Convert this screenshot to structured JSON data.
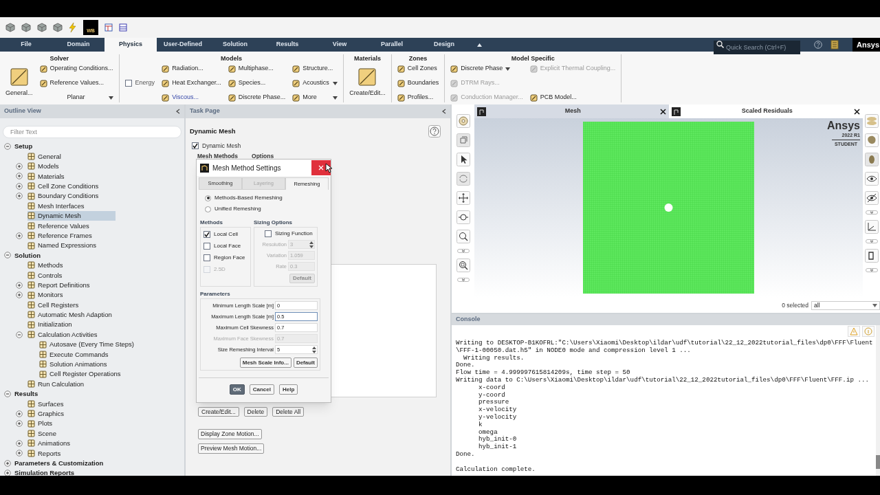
{
  "quick_access": {
    "badge": "WB"
  },
  "menu_tabs": [
    {
      "label": "File",
      "selected": false
    },
    {
      "label": "Domain",
      "selected": false
    },
    {
      "label": "Physics",
      "selected": true
    },
    {
      "label": "User-Defined",
      "selected": false
    },
    {
      "label": "Solution",
      "selected": false
    },
    {
      "label": "Results",
      "selected": false
    },
    {
      "label": "View",
      "selected": false
    },
    {
      "label": "Parallel",
      "selected": false
    },
    {
      "label": "Design",
      "selected": false
    }
  ],
  "quick_search": {
    "placeholder": "Quick Search (Ctrl+F)"
  },
  "brand": "Ansys",
  "ribbon": [
    {
      "title": "Solver",
      "columns": [
        [
          {
            "kind": "large",
            "label": "General...",
            "disabled": false,
            "highlighted": false
          }
        ],
        [
          {
            "kind": "small",
            "label": "Operating Conditions...",
            "disabled": false,
            "highlighted": false
          },
          {
            "kind": "small",
            "label": "Reference Values...",
            "disabled": false,
            "highlighted": false
          },
          {
            "kind": "select",
            "label": "Planar",
            "disabled": false,
            "highlighted": false
          }
        ]
      ]
    },
    {
      "title": "Models",
      "columns": [
        [
          {
            "kind": "check",
            "label": "Energy",
            "checked": false,
            "disabled": false,
            "highlighted": false
          }
        ],
        [
          {
            "kind": "small",
            "label": "Radiation...",
            "disabled": false,
            "highlighted": false
          },
          {
            "kind": "small",
            "label": "Heat Exchanger...",
            "disabled": false,
            "highlighted": false
          },
          {
            "kind": "small",
            "label": "Viscous...",
            "disabled": false,
            "highlighted": true
          }
        ],
        [
          {
            "kind": "small",
            "label": "Multiphase...",
            "disabled": false,
            "highlighted": false
          },
          {
            "kind": "small",
            "label": "Species...",
            "disabled": false,
            "highlighted": false
          },
          {
            "kind": "small",
            "label": "Discrete Phase...",
            "disabled": false,
            "highlighted": false
          }
        ],
        [
          {
            "kind": "small",
            "label": "Structure...",
            "disabled": false,
            "highlighted": false
          },
          {
            "kind": "menu",
            "label": "Acoustics",
            "disabled": false,
            "highlighted": false
          },
          {
            "kind": "menu",
            "label": "More",
            "disabled": false,
            "highlighted": false
          }
        ]
      ]
    },
    {
      "title": "Materials",
      "columns": [
        [
          {
            "kind": "large",
            "label": "Create/Edit...",
            "disabled": false,
            "highlighted": false
          }
        ]
      ]
    },
    {
      "title": "Zones",
      "columns": [
        [
          {
            "kind": "small",
            "label": "Cell Zones",
            "disabled": false,
            "highlighted": false
          },
          {
            "kind": "small",
            "label": "Boundaries",
            "disabled": false,
            "highlighted": false
          },
          {
            "kind": "small",
            "label": "Profiles...",
            "disabled": false,
            "highlighted": false
          }
        ]
      ]
    },
    {
      "title": "Model Specific",
      "columns": [
        [
          {
            "kind": "menu",
            "label": "Discrete Phase",
            "disabled": false,
            "highlighted": false
          },
          {
            "kind": "small",
            "label": "DTRM Rays...",
            "disabled": true,
            "highlighted": false
          },
          {
            "kind": "small",
            "label": "Conduction Manager...",
            "disabled": true,
            "highlighted": false
          }
        ],
        [
          {
            "kind": "small",
            "label": "Explicit Thermal Coupling...",
            "disabled": true,
            "highlighted": false
          },
          {
            "kind": "small",
            "label": "PCB Model...",
            "disabled": false,
            "highlighted": false
          }
        ]
      ]
    }
  ],
  "outline": {
    "title": "Outline View",
    "filter_placeholder": "Filter Text",
    "tree": [
      {
        "label": "Setup",
        "expanded": true,
        "selected": false,
        "children": [
          {
            "label": "General",
            "selected": false
          },
          {
            "label": "Models",
            "expanded": false,
            "selected": false
          },
          {
            "label": "Materials",
            "expanded": false,
            "selected": false
          },
          {
            "label": "Cell Zone Conditions",
            "expanded": false,
            "selected": false
          },
          {
            "label": "Boundary Conditions",
            "expanded": false,
            "selected": false
          },
          {
            "label": "Mesh Interfaces",
            "selected": false
          },
          {
            "label": "Dynamic Mesh",
            "selected": true
          },
          {
            "label": "Reference Values",
            "selected": false
          },
          {
            "label": "Reference Frames",
            "expanded": false,
            "selected": false
          },
          {
            "label": "Named Expressions",
            "selected": false
          }
        ]
      },
      {
        "label": "Solution",
        "expanded": true,
        "selected": false,
        "children": [
          {
            "label": "Methods",
            "selected": false
          },
          {
            "label": "Controls",
            "selected": false
          },
          {
            "label": "Report Definitions",
            "expanded": false,
            "selected": false
          },
          {
            "label": "Monitors",
            "expanded": false,
            "selected": false
          },
          {
            "label": "Cell Registers",
            "selected": false
          },
          {
            "label": "Automatic Mesh Adaption",
            "selected": false
          },
          {
            "label": "Initialization",
            "selected": false
          },
          {
            "label": "Calculation Activities",
            "expanded": true,
            "selected": false,
            "children": [
              {
                "label": "Autosave (Every Time Steps)",
                "selected": false
              },
              {
                "label": "Execute Commands",
                "selected": false
              },
              {
                "label": "Solution Animations",
                "selected": false
              },
              {
                "label": "Cell Register Operations",
                "selected": false
              }
            ]
          },
          {
            "label": "Run Calculation",
            "selected": false
          }
        ]
      },
      {
        "label": "Results",
        "expanded": true,
        "selected": false,
        "children": [
          {
            "label": "Surfaces",
            "selected": false
          },
          {
            "label": "Graphics",
            "expanded": false,
            "selected": false
          },
          {
            "label": "Plots",
            "expanded": false,
            "selected": false
          },
          {
            "label": "Scene",
            "selected": false
          },
          {
            "label": "Animations",
            "expanded": false,
            "selected": false
          },
          {
            "label": "Reports",
            "expanded": false,
            "selected": false
          }
        ]
      },
      {
        "label": "Parameters & Customization",
        "expanded": false,
        "selected": false
      },
      {
        "label": "Simulation Reports",
        "expanded": false,
        "selected": false
      }
    ]
  },
  "task_page": {
    "title": "Task Page",
    "heading": "Dynamic Mesh",
    "dynamic_mesh": {
      "label": "Dynamic Mesh",
      "checked": true
    },
    "section_labels": [
      "Mesh Methods",
      "Options"
    ],
    "zone_buttons": [
      "Create/Edit...",
      "Delete",
      "Delete All"
    ],
    "motion_buttons": [
      "Display Zone Motion...",
      "Preview Mesh Motion..."
    ]
  },
  "dialog": {
    "title": "Mesh Method Settings",
    "tabs": [
      {
        "label": "Smoothing",
        "selected": false,
        "disabled": false
      },
      {
        "label": "Layering",
        "selected": false,
        "disabled": true
      },
      {
        "label": "Remeshing",
        "selected": true,
        "disabled": false
      }
    ],
    "modes": [
      {
        "label": "Methods-Based Remeshing",
        "selected": true
      },
      {
        "label": "Unified Remeshing",
        "selected": false
      }
    ],
    "methods": {
      "title": "Methods",
      "options": [
        {
          "label": "Local Cell",
          "checked": true,
          "disabled": false
        },
        {
          "label": "Local Face",
          "checked": false,
          "disabled": false
        },
        {
          "label": "Region Face",
          "checked": false,
          "disabled": false
        },
        {
          "label": "2.5D",
          "checked": false,
          "disabled": true
        }
      ]
    },
    "sizing": {
      "title": "Sizing Options",
      "toggle": {
        "label": "Sizing Function",
        "checked": false
      },
      "fields": [
        {
          "kind": "spin",
          "label": "Resolution",
          "value": "3",
          "disabled": true
        },
        {
          "kind": "text",
          "label": "Variation",
          "value": "1.059",
          "disabled": true
        },
        {
          "kind": "text",
          "label": "Rate",
          "value": "0.3",
          "disabled": true
        }
      ],
      "default_button": {
        "label": "Default",
        "disabled": true
      }
    },
    "parameters": {
      "title": "Parameters",
      "fields": [
        {
          "kind": "text",
          "label": "Minimum Length Scale [m]",
          "value": "0",
          "disabled": false,
          "focused": false
        },
        {
          "kind": "text",
          "label": "Maximum Length Scale [m]",
          "value": "0.5",
          "disabled": false,
          "focused": true
        },
        {
          "kind": "text",
          "label": "Maximum Cell Skewness",
          "value": "0.7",
          "disabled": false,
          "focused": false
        },
        {
          "kind": "text",
          "label": "Maximum Face Skewness",
          "value": "0.7",
          "disabled": true,
          "focused": false
        },
        {
          "kind": "spin",
          "label": "Size Remeshing Interval",
          "value": "5",
          "disabled": false,
          "focused": false
        }
      ],
      "buttons": [
        "Mesh Scale Info...",
        "Default"
      ]
    },
    "footer": [
      {
        "label": "OK",
        "primary": true
      },
      {
        "label": "Cancel",
        "primary": false
      },
      {
        "label": "Help",
        "primary": false
      }
    ]
  },
  "graphics": {
    "tabs": [
      {
        "label": "Mesh",
        "selected": true
      },
      {
        "label": "Scaled Residuals",
        "selected": false
      }
    ],
    "logo": {
      "name": "Ansys",
      "version": "2022 R1",
      "edition": "STUDENT"
    },
    "selection": {
      "count": "0 selected",
      "filter": "all"
    }
  },
  "console": {
    "title": "Console",
    "lines": [
      "Writing to DESKTOP-B1KOFRL:\"C:\\Users\\Xiaomi\\Desktop\\ildar\\udf\\tutorial\\22_12_2022tutorial_files\\dp0\\FFF\\Fluent",
      "\\FFF-1-00050.dat.h5\" in NODE0 mode and compression level 1 ...",
      "  Writing results.",
      "Done.",
      "Flow time = 4.999997615814209s, time step = 50",
      "Writing data to C:\\Users\\Xiaomi\\Desktop\\ildar\\udf\\tutorial\\22_12_2022tutorial_files\\dp0\\FFF\\Fluent\\FFF.ip ...",
      "      x-coord",
      "      y-coord",
      "      pressure",
      "      x-velocity",
      "      y-velocity",
      "      k",
      "      omega",
      "      hyb_init-0",
      "      hyb_init-1",
      "Done."
    ],
    "final_line": "Calculation complete."
  }
}
